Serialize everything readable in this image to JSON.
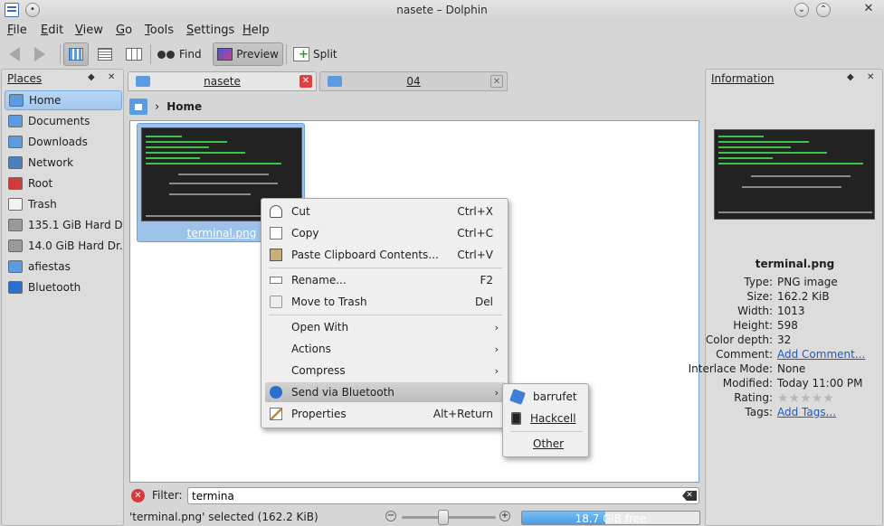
{
  "window": {
    "title": "nasete – Dolphin"
  },
  "menubar": {
    "items": [
      "File",
      "Edit",
      "View",
      "Go",
      "Tools",
      "Settings",
      "Help"
    ]
  },
  "toolbar": {
    "find_label": "Find",
    "preview_label": "Preview",
    "split_label": "Split"
  },
  "places": {
    "title": "Places",
    "items": [
      {
        "label": "Home",
        "icon": "home-folder-icon",
        "color": "#5b9be0"
      },
      {
        "label": "Documents",
        "icon": "folder-icon",
        "color": "#5b9be0"
      },
      {
        "label": "Downloads",
        "icon": "download-folder-icon",
        "color": "#5b9be0"
      },
      {
        "label": "Network",
        "icon": "network-icon",
        "color": "#4a7fc0"
      },
      {
        "label": "Root",
        "icon": "root-folder-icon",
        "color": "#d23a3a"
      },
      {
        "label": "Trash",
        "icon": "trash-icon",
        "color": "#f2f2f2"
      },
      {
        "label": "135.1 GiB Hard D...",
        "icon": "hard-drive-icon",
        "color": "#9a9a9a"
      },
      {
        "label": "14.0 GiB Hard Dr...",
        "icon": "hard-drive-icon",
        "color": "#9a9a9a"
      },
      {
        "label": "afiestas",
        "icon": "network-folder-icon",
        "color": "#5b9be0"
      },
      {
        "label": "Bluetooth",
        "icon": "bluetooth-icon",
        "color": "#2a6fd0"
      }
    ]
  },
  "tabs": [
    {
      "label": "nasete"
    },
    {
      "label": "04"
    }
  ],
  "breadcrumb": {
    "current": "Home"
  },
  "file": {
    "name": "terminal.png"
  },
  "context_menu": {
    "items": [
      {
        "label": "Cut",
        "shortcut": "Ctrl+X"
      },
      {
        "label": "Copy",
        "shortcut": "Ctrl+C"
      },
      {
        "label": "Paste Clipboard Contents...",
        "shortcut": "Ctrl+V"
      },
      {
        "label": "Rename...",
        "shortcut": "F2"
      },
      {
        "label": "Move to Trash",
        "shortcut": "Del"
      },
      {
        "label": "Open With",
        "shortcut": ""
      },
      {
        "label": "Actions",
        "shortcut": ""
      },
      {
        "label": "Compress",
        "shortcut": ""
      },
      {
        "label": "Send via Bluetooth",
        "shortcut": ""
      },
      {
        "label": "Properties",
        "shortcut": "Alt+Return"
      }
    ]
  },
  "bluetooth_submenu": {
    "items": [
      "barrufet",
      "Hackcell",
      "Other"
    ]
  },
  "info": {
    "title": "Information",
    "filename": "terminal.png",
    "rows": [
      {
        "key": "Type:",
        "value": "PNG image"
      },
      {
        "key": "Size:",
        "value": "162.2 KiB"
      },
      {
        "key": "Width:",
        "value": "1013"
      },
      {
        "key": "Height:",
        "value": "598"
      },
      {
        "key": "Color depth:",
        "value": "32"
      },
      {
        "key": "Comment:",
        "value": "Add Comment..."
      },
      {
        "key": "Interlace Mode:",
        "value": "None"
      },
      {
        "key": "Modified:",
        "value": "Today 11:00 PM"
      },
      {
        "key": "Rating:",
        "value": ""
      },
      {
        "key": "Tags:",
        "value": "Add Tags..."
      }
    ],
    "rating": 0
  },
  "filter": {
    "label": "Filter:",
    "value": "termina"
  },
  "status": {
    "text": "'terminal.png' selected (162.2 KiB)",
    "free_text": "18.7 GiB free",
    "free_fraction": 0.47
  },
  "colors": {
    "accent": "#a3c8ef",
    "selection": "#9cc2ea",
    "freebar": "#4a9ee8",
    "link": "#1f5bb8"
  }
}
